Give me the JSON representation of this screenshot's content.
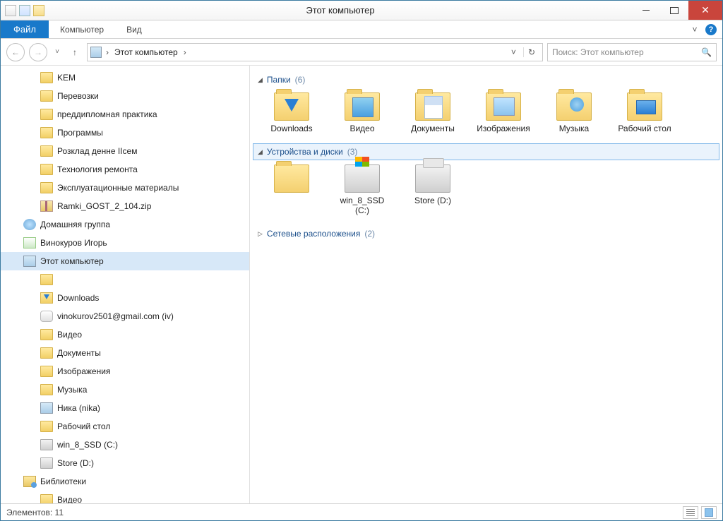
{
  "title": "Этот компьютер",
  "ribbon": {
    "file": "Файл",
    "tabs": [
      "Компьютер",
      "Вид"
    ]
  },
  "nav": {
    "address_root": "Этот компьютер",
    "search_placeholder": "Поиск: Этот компьютер"
  },
  "tree": [
    {
      "label": "KEM",
      "icon": "folder-ico",
      "level": 1
    },
    {
      "label": "Перевозки",
      "icon": "folder-ico",
      "level": 1
    },
    {
      "label": "преддипломная практика",
      "icon": "folder-ico",
      "level": 1
    },
    {
      "label": "Программы",
      "icon": "folder-ico",
      "level": 1
    },
    {
      "label": "Розклад денне IIсем",
      "icon": "folder-ico",
      "level": 1
    },
    {
      "label": "Технология ремонта",
      "icon": "folder-ico",
      "level": 1
    },
    {
      "label": "Эксплуатационные материалы",
      "icon": "folder-ico",
      "level": 1
    },
    {
      "label": "Ramki_GOST_2_104.zip",
      "icon": "zip-ico",
      "level": 1
    },
    {
      "label": "Домашняя группа",
      "icon": "group-ico",
      "level": 0
    },
    {
      "label": "Винокуров Игорь",
      "icon": "user-ico",
      "level": 0
    },
    {
      "label": "Этот компьютер",
      "icon": "pc-ico",
      "level": 0,
      "selected": true
    },
    {
      "label": "",
      "icon": "folder-ico",
      "level": 1
    },
    {
      "label": "Downloads",
      "icon": "dl-ico",
      "level": 1
    },
    {
      "label": "vinokurov2501@gmail.com (iv)",
      "icon": "cloud-ico",
      "level": 1
    },
    {
      "label": "Видео",
      "icon": "folder-ico",
      "level": 1
    },
    {
      "label": "Документы",
      "icon": "folder-ico",
      "level": 1
    },
    {
      "label": "Изображения",
      "icon": "folder-ico",
      "level": 1
    },
    {
      "label": "Музыка",
      "icon": "folder-ico",
      "level": 1
    },
    {
      "label": "Ника (nika)",
      "icon": "pc-ico",
      "level": 1
    },
    {
      "label": "Рабочий стол",
      "icon": "folder-ico",
      "level": 1
    },
    {
      "label": "win_8_SSD (C:)",
      "icon": "drive-ico",
      "level": 1
    },
    {
      "label": "Store (D:)",
      "icon": "drive-ico",
      "level": 1
    },
    {
      "label": "Библиотеки",
      "icon": "lib-ico",
      "level": 0
    },
    {
      "label": "Видео",
      "icon": "folder-ico",
      "level": 1
    }
  ],
  "groups": {
    "folders": {
      "title": "Папки",
      "count": "(6)",
      "expanded": true,
      "selected": false
    },
    "devices": {
      "title": "Устройства и диски",
      "count": "(3)",
      "expanded": true,
      "selected": true
    },
    "network": {
      "title": "Сетевые расположения",
      "count": "(2)",
      "expanded": false
    }
  },
  "folders_items": [
    {
      "label": "Downloads",
      "kind": "dl"
    },
    {
      "label": "Видео",
      "kind": "vid"
    },
    {
      "label": "Документы",
      "kind": "doc"
    },
    {
      "label": "Изображения",
      "kind": "img"
    },
    {
      "label": "Музыка",
      "kind": "mus"
    },
    {
      "label": "Рабочий стол",
      "kind": "desk"
    }
  ],
  "devices_items": [
    {
      "label": "",
      "kind": "folder"
    },
    {
      "label": "win_8_SSD (C:)",
      "kind": "drive win"
    },
    {
      "label": "Store (D:)",
      "kind": "drive store"
    }
  ],
  "status": {
    "text": "Элементов: 11"
  }
}
